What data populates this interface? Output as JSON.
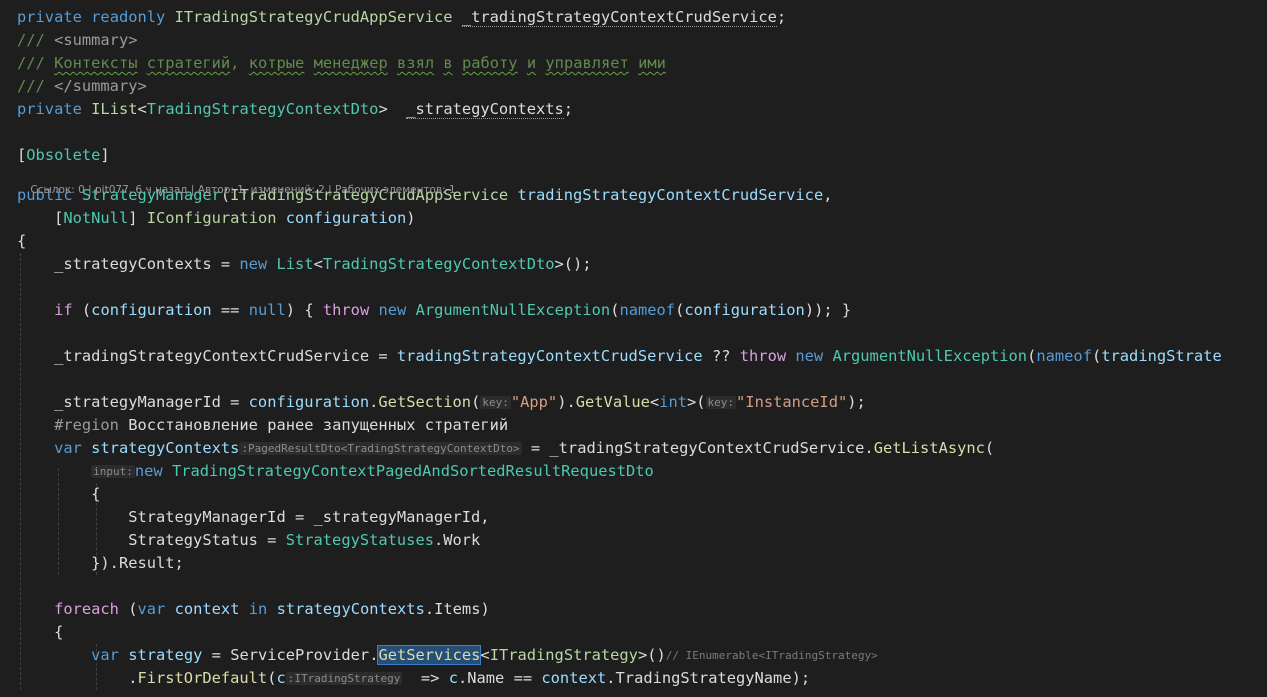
{
  "editor": {
    "lines": [
      {
        "tokens": [
          {
            "t": "private",
            "c": "kw"
          },
          {
            "t": " "
          },
          {
            "t": "readonly",
            "c": "kw"
          },
          {
            "t": " "
          },
          {
            "t": "ITradingStrategyCrudAppService",
            "c": "itf"
          },
          {
            "t": " "
          },
          {
            "t": "_tradingStrategyContextCrudService",
            "c": "txt",
            "deco": "dot"
          },
          {
            "t": ";"
          }
        ]
      },
      {
        "tokens": [
          {
            "t": "/// ",
            "c": "doc"
          },
          {
            "t": "<summary>",
            "c": "prep"
          }
        ]
      },
      {
        "tokens": [
          {
            "t": "/// ",
            "c": "doc"
          },
          {
            "t": "Контексты",
            "c": "doc",
            "deco": "sq"
          },
          {
            "t": " ",
            "c": "doc"
          },
          {
            "t": "стратегий",
            "c": "doc",
            "deco": "sq"
          },
          {
            "t": ", ",
            "c": "doc"
          },
          {
            "t": "котрые",
            "c": "doc",
            "deco": "sq"
          },
          {
            "t": " ",
            "c": "doc"
          },
          {
            "t": "менеджер",
            "c": "doc",
            "deco": "sq"
          },
          {
            "t": " ",
            "c": "doc"
          },
          {
            "t": "взял",
            "c": "doc",
            "deco": "sq"
          },
          {
            "t": " ",
            "c": "doc"
          },
          {
            "t": "в",
            "c": "doc",
            "deco": "sq"
          },
          {
            "t": " ",
            "c": "doc"
          },
          {
            "t": "работу",
            "c": "doc",
            "deco": "sq"
          },
          {
            "t": " ",
            "c": "doc"
          },
          {
            "t": "и",
            "c": "doc",
            "deco": "sq"
          },
          {
            "t": " ",
            "c": "doc"
          },
          {
            "t": "управляет",
            "c": "doc",
            "deco": "sq"
          },
          {
            "t": " ",
            "c": "doc"
          },
          {
            "t": "ими",
            "c": "doc",
            "deco": "sq"
          }
        ]
      },
      {
        "tokens": [
          {
            "t": "/// ",
            "c": "doc"
          },
          {
            "t": "</summary>",
            "c": "prep"
          }
        ]
      },
      {
        "tokens": [
          {
            "t": "private",
            "c": "kw"
          },
          {
            "t": " "
          },
          {
            "t": "IList",
            "c": "itf"
          },
          {
            "t": "<"
          },
          {
            "t": "TradingStrategyContextDto",
            "c": "type"
          },
          {
            "t": ">  "
          },
          {
            "t": "_strategyContexts",
            "c": "txt",
            "deco": "dot"
          },
          {
            "t": ";"
          }
        ]
      },
      {
        "tokens": []
      },
      {
        "tokens": [
          {
            "t": "["
          },
          {
            "t": "Obsolete",
            "c": "type"
          },
          {
            "t": "]"
          }
        ]
      },
      {
        "tokens": [
          {
            "t": "public",
            "c": "kw"
          },
          {
            "t": " "
          },
          {
            "t": "StrategyManager",
            "c": "type"
          },
          {
            "t": "("
          },
          {
            "t": "ITradingStrategyCrudAppService",
            "c": "itf"
          },
          {
            "t": " "
          },
          {
            "t": "tradingStrategyContextCrudService",
            "c": "par"
          },
          {
            "t": ","
          }
        ]
      },
      {
        "tokens": [
          {
            "t": "    ["
          },
          {
            "t": "NotNull",
            "c": "type"
          },
          {
            "t": "] "
          },
          {
            "t": "IConfiguration",
            "c": "itf"
          },
          {
            "t": " "
          },
          {
            "t": "configuration",
            "c": "par"
          },
          {
            "t": ")"
          }
        ]
      },
      {
        "tokens": [
          {
            "t": "{"
          }
        ]
      },
      {
        "tokens": [
          {
            "t": "    _strategyContexts = "
          },
          {
            "t": "new",
            "c": "kw"
          },
          {
            "t": " "
          },
          {
            "t": "List",
            "c": "type"
          },
          {
            "t": "<"
          },
          {
            "t": "TradingStrategyContextDto",
            "c": "type"
          },
          {
            "t": ">();"
          }
        ]
      },
      {
        "tokens": []
      },
      {
        "tokens": [
          {
            "t": "    "
          },
          {
            "t": "if",
            "c": "ctl"
          },
          {
            "t": " ("
          },
          {
            "t": "configuration",
            "c": "par"
          },
          {
            "t": " == "
          },
          {
            "t": "null",
            "c": "kw"
          },
          {
            "t": ") { "
          },
          {
            "t": "throw",
            "c": "ctl"
          },
          {
            "t": " "
          },
          {
            "t": "new",
            "c": "kw"
          },
          {
            "t": " "
          },
          {
            "t": "ArgumentNullException",
            "c": "type"
          },
          {
            "t": "("
          },
          {
            "t": "nameof",
            "c": "kw"
          },
          {
            "t": "("
          },
          {
            "t": "configuration",
            "c": "par"
          },
          {
            "t": ")); }"
          }
        ]
      },
      {
        "tokens": []
      },
      {
        "tokens": [
          {
            "t": "    _tradingStrategyContextCrudService = "
          },
          {
            "t": "tradingStrategyContextCrudService",
            "c": "par"
          },
          {
            "t": " ?? "
          },
          {
            "t": "throw",
            "c": "ctl"
          },
          {
            "t": " "
          },
          {
            "t": "new",
            "c": "kw"
          },
          {
            "t": " "
          },
          {
            "t": "ArgumentNullException",
            "c": "type"
          },
          {
            "t": "("
          },
          {
            "t": "nameof",
            "c": "kw"
          },
          {
            "t": "("
          },
          {
            "t": "tradingStrate",
            "c": "par"
          }
        ]
      },
      {
        "tokens": []
      },
      {
        "tokens": [
          {
            "t": "    _strategyManagerId = "
          },
          {
            "t": "configuration",
            "c": "par"
          },
          {
            "t": "."
          },
          {
            "t": "GetSection",
            "c": "fn"
          },
          {
            "t": "("
          },
          {
            "t": "key:",
            "c": "hint"
          },
          {
            "t": "\"App\"",
            "c": "str"
          },
          {
            "t": ")."
          },
          {
            "t": "GetValue",
            "c": "fn"
          },
          {
            "t": "<"
          },
          {
            "t": "int",
            "c": "kw"
          },
          {
            "t": ">("
          },
          {
            "t": "key:",
            "c": "hint"
          },
          {
            "t": "\"InstanceId\"",
            "c": "str"
          },
          {
            "t": ");"
          }
        ]
      },
      {
        "tokens": [
          {
            "t": "    "
          },
          {
            "t": "#region",
            "c": "prep"
          },
          {
            "t": " Восстановление ранее запущенных стратегий"
          }
        ]
      },
      {
        "tokens": [
          {
            "t": "    "
          },
          {
            "t": "var",
            "c": "kw"
          },
          {
            "t": " "
          },
          {
            "t": "strategyContexts",
            "c": "par"
          },
          {
            "t": ":PagedResultDto<TradingStrategyContextDto>",
            "c": "hint"
          },
          {
            "t": " = _tradingStrategyContextCrudService."
          },
          {
            "t": "GetListAsync",
            "c": "fn"
          },
          {
            "t": "("
          }
        ]
      },
      {
        "tokens": [
          {
            "t": "        "
          },
          {
            "t": "input:",
            "c": "hint"
          },
          {
            "t": "new",
            "c": "kw"
          },
          {
            "t": " "
          },
          {
            "t": "TradingStrategyContextPagedAndSortedResultRequestDto",
            "c": "type"
          }
        ]
      },
      {
        "tokens": [
          {
            "t": "        {"
          }
        ]
      },
      {
        "tokens": [
          {
            "t": "            StrategyManagerId = _strategyManagerId,"
          }
        ]
      },
      {
        "tokens": [
          {
            "t": "            StrategyStatus = "
          },
          {
            "t": "StrategyStatuses",
            "c": "type"
          },
          {
            "t": ".Work"
          }
        ]
      },
      {
        "tokens": [
          {
            "t": "        })."
          },
          {
            "t": "Result",
            "c": "txt"
          },
          {
            "t": ";"
          }
        ]
      },
      {
        "tokens": []
      },
      {
        "tokens": [
          {
            "t": "    "
          },
          {
            "t": "foreach",
            "c": "ctl"
          },
          {
            "t": " ("
          },
          {
            "t": "var",
            "c": "kw"
          },
          {
            "t": " "
          },
          {
            "t": "context",
            "c": "par"
          },
          {
            "t": " "
          },
          {
            "t": "in",
            "c": "kw"
          },
          {
            "t": " "
          },
          {
            "t": "strategyContexts",
            "c": "par"
          },
          {
            "t": "."
          },
          {
            "t": "Items",
            "c": "txt"
          },
          {
            "t": ")"
          }
        ]
      },
      {
        "tokens": [
          {
            "t": "    {"
          }
        ]
      },
      {
        "tokens": [
          {
            "t": "        "
          },
          {
            "t": "var",
            "c": "kw"
          },
          {
            "t": " "
          },
          {
            "t": "strategy",
            "c": "par"
          },
          {
            "t": " = "
          },
          {
            "t": "ServiceProvider",
            "c": "txt"
          },
          {
            "t": "."
          },
          {
            "t": "GetServices",
            "c": "fn",
            "deco": "sel"
          },
          {
            "t": "<"
          },
          {
            "t": "ITradingStrategy",
            "c": "itf"
          },
          {
            "t": ">()"
          },
          {
            "t": "// IEnumerable<ITradingStrategy>",
            "c": "ghint"
          }
        ]
      },
      {
        "tokens": [
          {
            "t": "            ."
          },
          {
            "t": "FirstOrDefault",
            "c": "fn"
          },
          {
            "t": "("
          },
          {
            "t": "c",
            "c": "par"
          },
          {
            "t": ":ITradingStrategy",
            "c": "hint"
          },
          {
            "t": "  => "
          },
          {
            "t": "c",
            "c": "par"
          },
          {
            "t": ".Name == "
          },
          {
            "t": "context",
            "c": "par"
          },
          {
            "t": ".TradingStrategyName);"
          }
        ]
      }
    ],
    "codelens": {
      "references": "Ссылок: 0",
      "author_time": "pit077, 6 ч назад",
      "authors": "Автор: 1, изменений: 2",
      "work_items": "Рабочих элементов: 1"
    }
  }
}
